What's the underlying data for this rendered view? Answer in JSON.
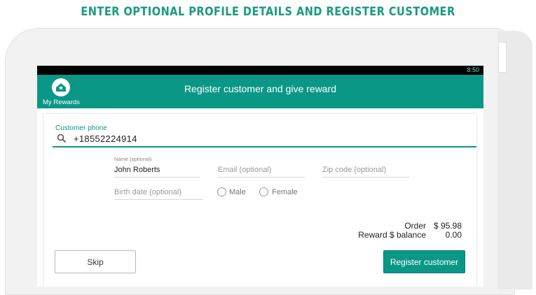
{
  "headline": "ENTER OPTIONAL PROFILE DETAILS AND REGISTER CUSTOMER",
  "status_bar": {
    "time": "8:50"
  },
  "app_bar": {
    "logo_label": "My Rewards",
    "title": "Register customer and give reward",
    "logo_icon": "home-star-icon"
  },
  "form": {
    "phone": {
      "label": "Customer phone",
      "value": "+18552224914",
      "icon": "search-icon"
    },
    "name": {
      "label": "Name (optional)",
      "value": "John Roberts"
    },
    "email": {
      "placeholder": "Email (optional)"
    },
    "zip": {
      "placeholder": "Zip code (optional)"
    },
    "birth_date": {
      "placeholder": "Birth date (optional)"
    },
    "gender_options": [
      "Male",
      "Female"
    ]
  },
  "totals": {
    "order_label": "Order",
    "order_value": "$ 95.98",
    "reward_label": "Reward $ balance",
    "reward_value": "0.00"
  },
  "buttons": {
    "skip": "Skip",
    "register": "Register customer"
  },
  "colors": {
    "accent": "#0a9786",
    "headline": "#1a9a7f"
  }
}
